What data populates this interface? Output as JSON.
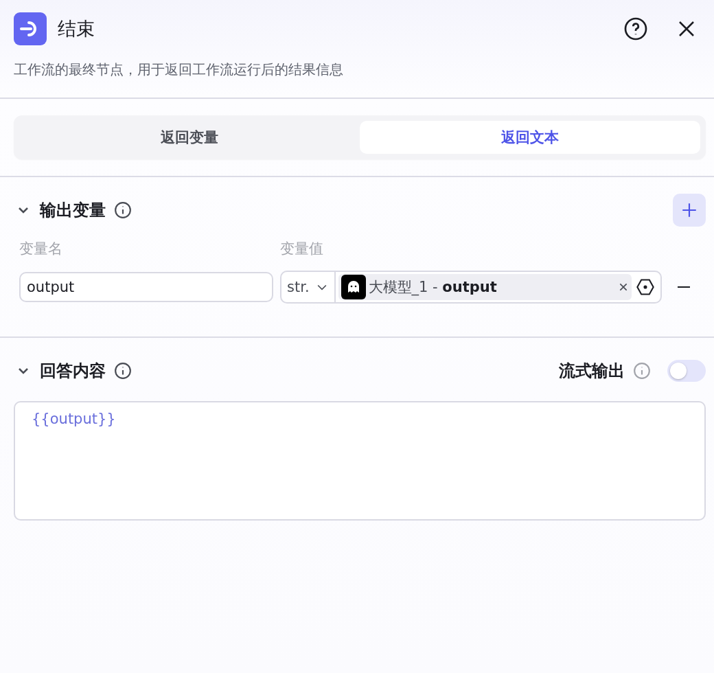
{
  "header": {
    "title": "结束",
    "description": "工作流的最终节点，用于返回工作流运行后的结果信息"
  },
  "tabs": [
    {
      "label": "返回变量",
      "selected": false
    },
    {
      "label": "返回文本",
      "selected": true
    }
  ],
  "output_variables": {
    "title": "输出变量",
    "expanded": true,
    "columns": [
      "变量名",
      "变量值"
    ],
    "rows": [
      {
        "name": "output",
        "type": "str.",
        "reference": "大模型_1 - **output**"
      }
    ]
  },
  "answer": {
    "title": "回答内容",
    "expanded": true,
    "streaming_label": "流式输出",
    "streaming": false,
    "content": "{{output}}"
  }
}
